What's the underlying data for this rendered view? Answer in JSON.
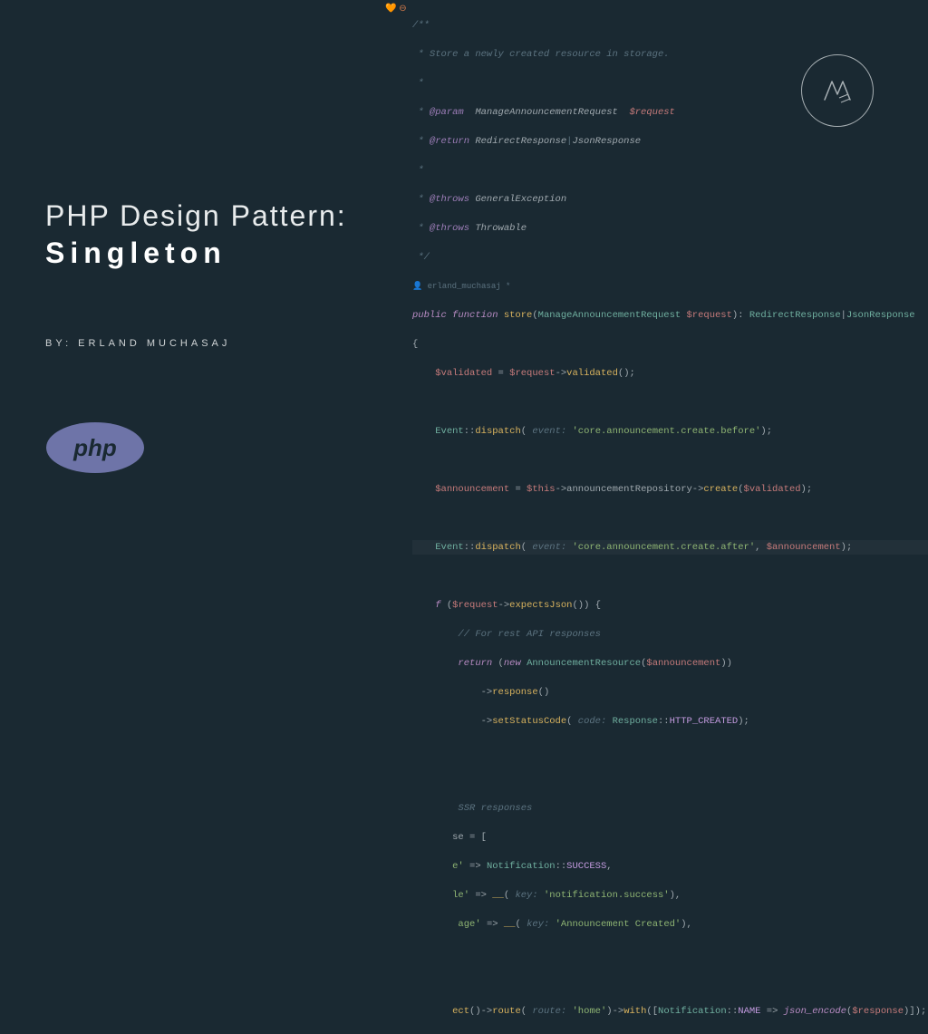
{
  "title_line1": "PHP Design Pattern:",
  "title_line2": "Singleton",
  "author_label": "BY: ERLAND MUCHASAJ",
  "logo_letter": "M",
  "gutter_icons": "🧡  ⊖",
  "code": {
    "l1": "/**",
    "l2_a": " * ",
    "l2_b": "Store a newly created resource in storage.",
    "l3": " *",
    "l4_a": " * ",
    "l4_tag": "@param",
    "l4_type": "  ManageAnnouncementRequest  ",
    "l4_var": "$request",
    "l5_a": " * ",
    "l5_tag": "@return",
    "l5_type": " RedirectResponse",
    "l5_pipe": "|",
    "l5_type2": "JsonResponse",
    "l6": " *",
    "l7_a": " * ",
    "l7_tag": "@throws",
    "l7_type": " GeneralException",
    "l8_a": " * ",
    "l8_tag": "@throws",
    "l8_type": " Throwable",
    "l9": " */",
    "author_hint_icon": "👤 ",
    "author_hint": "erland_muchasaj *",
    "l10_kw1": "public ",
    "l10_kw2": "function ",
    "l10_fn": "store",
    "l10_p1": "(",
    "l10_type": "ManageAnnouncementRequest ",
    "l10_var": "$request",
    "l10_p2": "): ",
    "l10_ret1": "RedirectResponse",
    "l10_pipe": "|",
    "l10_ret2": "JsonResponse",
    "l11": "{",
    "l12_pad": "    ",
    "l12_var": "$validated",
    "l12_eq": " = ",
    "l12_var2": "$request",
    "l12_arrow": "->",
    "l12_m": "validated",
    "l12_end": "();",
    "l14_pad": "    ",
    "l14_cls": "Event",
    "l14_sc": "::",
    "l14_m": "dispatch",
    "l14_p": "( ",
    "l14_hint": "event: ",
    "l14_str": "'core.announcement.create.before'",
    "l14_end": ");",
    "l16_pad": "    ",
    "l16_var": "$announcement",
    "l16_eq": " = ",
    "l16_this": "$this",
    "l16_a1": "->",
    "l16_prop": "announcementRepository",
    "l16_a2": "->",
    "l16_m": "create",
    "l16_p1": "(",
    "l16_var2": "$validated",
    "l16_end": ");",
    "l18_pad": "    ",
    "l18_cls": "Event",
    "l18_sc": "::",
    "l18_m": "dispatch",
    "l18_p": "( ",
    "l18_hint": "event: ",
    "l18_str": "'core.announcement.create.after'",
    "l18_c": ", ",
    "l18_var": "$announcement",
    "l18_end": ");",
    "l20_pad": "    ",
    "l20_if": "f ",
    "l20_p1": "(",
    "l20_var": "$request",
    "l20_arrow": "->",
    "l20_m": "expectsJson",
    "l20_end": "()) {",
    "l21_pad": "        ",
    "l21": "// For rest API responses",
    "l22_pad": "        ",
    "l22_kw": "return ",
    "l22_p1": "(",
    "l22_new": "new ",
    "l22_cls": "AnnouncementResource",
    "l22_p2": "(",
    "l22_var": "$announcement",
    "l22_end": "))",
    "l23_pad": "            ",
    "l23_arrow": "->",
    "l23_m": "response",
    "l23_end": "()",
    "l24_pad": "            ",
    "l24_arrow": "->",
    "l24_m": "setStatusCode",
    "l24_p": "( ",
    "l24_hint": "code: ",
    "l24_cls": "Response",
    "l24_sc": "::",
    "l24_const": "HTTP_CREATED",
    "l24_end": ");",
    "l27_pad": "        ",
    "l27": "SSR responses",
    "l28_pad": "       ",
    "l28_var": "se",
    "l28_eq": " = [",
    "l29_pad": "       ",
    "l29_key": "e'",
    "l29_arrow": " => ",
    "l29_cls": "Notification",
    "l29_sc": "::",
    "l29_const": "SUCCESS",
    "l29_end": ",",
    "l30_pad": "       ",
    "l30_key": "le'",
    "l30_arrow": " => ",
    "l30_fn": "__",
    "l30_p": "( ",
    "l30_hint": "key: ",
    "l30_str": "'notification.success'",
    "l30_end": "),",
    "l31_pad": "        ",
    "l31_key": "age'",
    "l31_arrow": " => ",
    "l31_fn": "__",
    "l31_p": "( ",
    "l31_hint": "key: ",
    "l31_str": "'Announcement Created'",
    "l31_end": "),",
    "l34_pad": "       ",
    "l34_m1": "ect",
    "l34_e1": "()",
    "l34_a1": "->",
    "l34_m2": "route",
    "l34_p2": "( ",
    "l34_hint": "route: ",
    "l34_str": "'home'",
    "l34_e2": ")",
    "l34_a2": "->",
    "l34_m3": "with",
    "l34_p3": "([",
    "l34_cls": "Notification",
    "l34_sc": "::",
    "l34_const": "NAME",
    "l34_arrow": " => ",
    "l34_fn": "json_encode",
    "l34_p4": "(",
    "l34_var": "$response",
    "l34_end": ")]);"
  }
}
